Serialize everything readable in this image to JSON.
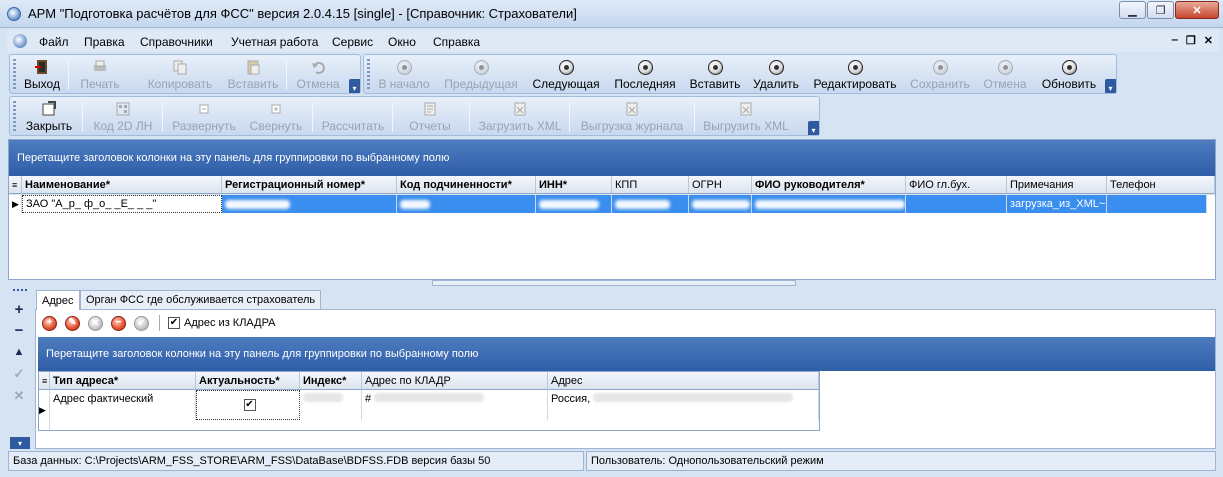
{
  "window": {
    "title": "АРМ \"Подготовка расчётов для ФСС\"   версия 2.0.4.15 [single] - [Справочник: Страхователи]"
  },
  "menu": [
    "Файл",
    "Правка",
    "Справочники",
    "Учетная работа",
    "Сервис",
    "Окно",
    "Справка"
  ],
  "toolbar1": {
    "exit": "Выход",
    "print": "Печать",
    "copy": "Копировать",
    "paste": "Вставить",
    "undo": "Отмена"
  },
  "toolbar2": {
    "first": "В начало",
    "prev": "Предыдущая",
    "next": "Следующая",
    "last": "Последняя",
    "insert": "Вставить",
    "delete": "Удалить",
    "edit": "Редактировать",
    "save": "Сохранить",
    "cancel": "Отмена",
    "refresh": "Обновить"
  },
  "toolbar3": {
    "close": "Закрыть",
    "code2d": "Код 2D  ЛН",
    "expand": "Развернуть",
    "collapse": "Свернуть",
    "calc": "Рассчитать",
    "reports": "Отчеты",
    "loadxml": "Загрузить XML",
    "exportlog": "Выгрузка журнала",
    "exportxml": "Выгрузить XML"
  },
  "group_hint": "Перетащите заголовок колонки на эту панель для группировки по выбранному полю",
  "main_grid": {
    "columns": [
      "Наименование*",
      "Регистрационный номер*",
      "Код подчиненности*",
      "ИНН*",
      "КПП",
      "ОГРН",
      "ФИО руководителя*",
      "ФИО гл.бух.",
      "Примечания",
      "Телефон"
    ],
    "row": {
      "name": "ЗАО \"А_р_ ф_о_ _Е_ _ _\"",
      "notes": "загрузка_из_XML~"
    }
  },
  "tabs": [
    "Адрес",
    "Орган ФСС где обслуживается страхователь"
  ],
  "kladr_checkbox": {
    "label": "Адрес из КЛАДРА",
    "checked": true
  },
  "addr_grid": {
    "columns": [
      "Тип адреса*",
      "Актуальность*",
      "Индекс*",
      "Адрес по КЛАДР",
      "Адрес"
    ],
    "row": {
      "type": "Адрес фактический",
      "actual": "✔",
      "address": "Россия,"
    }
  },
  "status": {
    "db": "База данных: C:\\Projects\\ARM_FSS_STORE\\ARM_FSS\\DataBase\\BDFSS.FDB   версия базы 50",
    "user": "Пользователь: Однопользовательский режим"
  }
}
